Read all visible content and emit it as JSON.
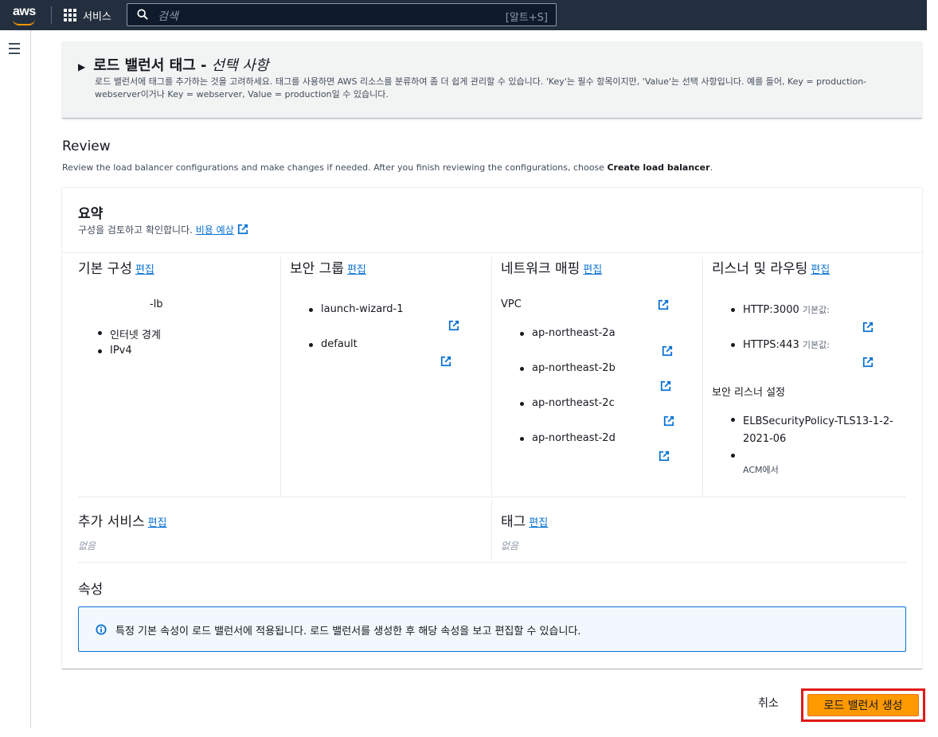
{
  "nav": {
    "logo_text": "aws",
    "services_label": "서비스",
    "search_placeholder": "검색",
    "search_shortcut": "[알트+S]"
  },
  "tags_section": {
    "title": "로드 밸런서 태그 -",
    "optional": "선택 사항",
    "description": "로드 밸런서에 태그를 추가하는 것을 고려하세요. 태그를 사용하면 AWS 리소스를 분류하여 좀 더 쉽게 관리할 수 있습니다. 'Key'는 필수 항목이지만, 'Value'는 선택 사항입니다. 예를 들어, Key = production-webserver이거나 Key = webserver, Value = production일 수 있습니다."
  },
  "review": {
    "title": "Review",
    "description_pre": "Review the load balancer configurations and make changes if needed. After you finish reviewing the configurations, choose ",
    "description_bold": "Create load balancer",
    "description_post": "."
  },
  "summary": {
    "title": "요약",
    "description": "구성을 검토하고 확인합니다.",
    "cost_link": "비용 예상",
    "edit_label": "편집",
    "basic": {
      "title": "기본 구성",
      "name": "-lb",
      "items": [
        "인터넷 경계",
        "IPv4"
      ]
    },
    "security_groups": {
      "title": "보안 그룹",
      "items": [
        "launch-wizard-1",
        "default"
      ]
    },
    "network": {
      "title": "네트워크 매핑",
      "vpc_label": "VPC",
      "zones": [
        "ap-northeast-2a",
        "ap-northeast-2b",
        "ap-northeast-2c",
        "ap-northeast-2d"
      ]
    },
    "listeners": {
      "title": "리스너 및 라우팅",
      "items": [
        {
          "protocol": "HTTP:3000",
          "note": "기본값:"
        },
        {
          "protocol": "HTTPS:443",
          "note": "기본값:"
        }
      ],
      "secure_title": "보안 리스너 설정",
      "policy": "ELBSecurityPolicy-TLS13-1-2-2021-06",
      "acm_note": "ACM에서"
    },
    "addons": {
      "title": "추가 서비스",
      "value": "없음"
    },
    "tags": {
      "title": "태그",
      "value": "없음"
    },
    "attributes": {
      "title": "속성",
      "info": "특정 기본 속성이 로드 밸런서에 적용됩니다. 로드 밸런서를 생성한 후 해당 속성을 보고 편집할 수 있습니다."
    }
  },
  "footer": {
    "cancel_label": "취소",
    "create_label": "로드 밸런서 생성"
  }
}
